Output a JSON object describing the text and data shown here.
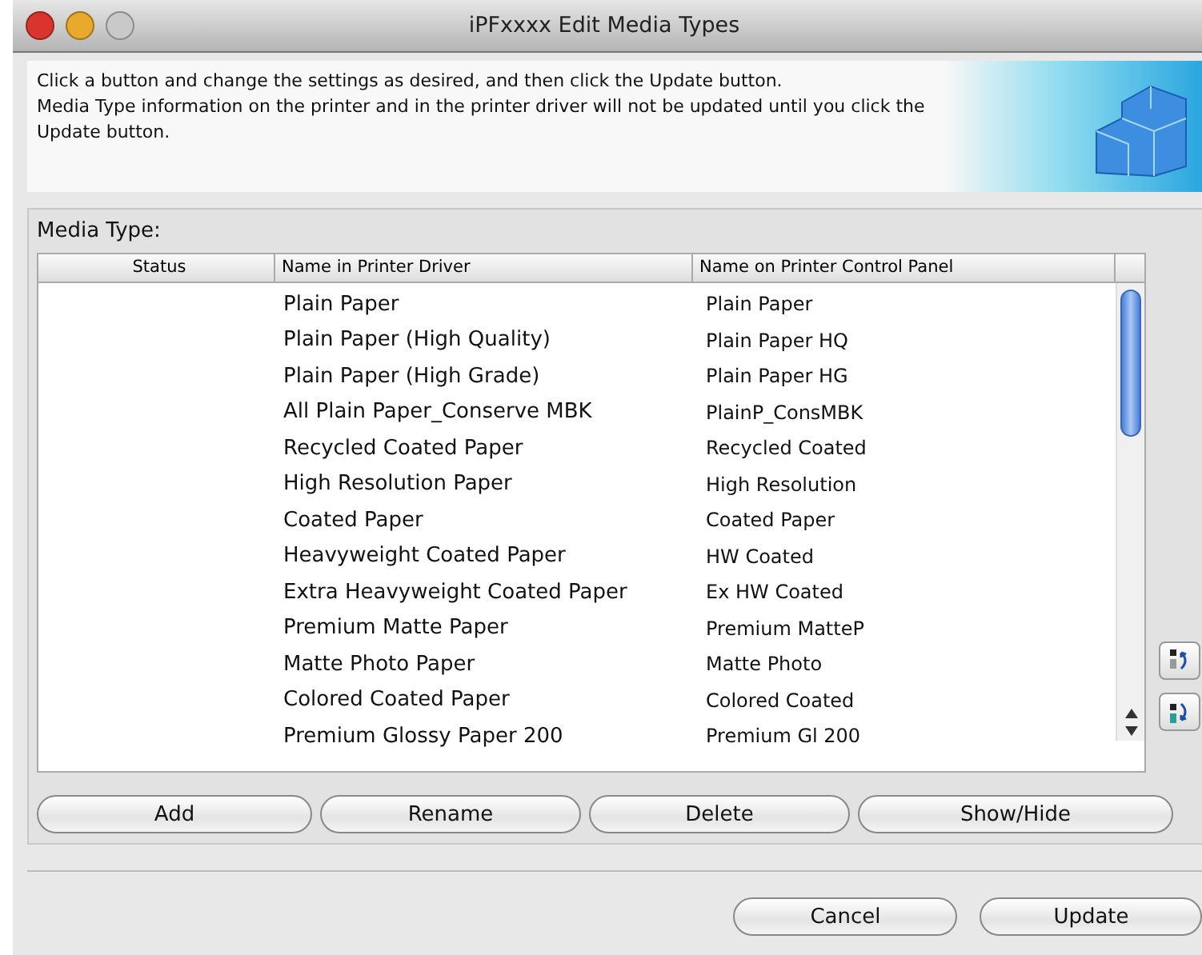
{
  "window": {
    "title": "iPFxxxx Edit Media Types"
  },
  "info": {
    "lines": [
      "Click a button and change the settings as desired, and then click the Update button.",
      "Media Type information on the printer and in the printer driver will not be updated until you click the Update button."
    ]
  },
  "media_type": {
    "label": "Media Type:",
    "table": {
      "columns": [
        "Status",
        "Name in Printer Driver",
        "Name on Printer Control Panel"
      ],
      "rows": [
        {
          "driver": "Plain Paper",
          "panel": "Plain Paper"
        },
        {
          "driver": "Plain Paper (High Quality)",
          "panel": "Plain Paper HQ"
        },
        {
          "driver": "Plain Paper (High Grade)",
          "panel": "Plain Paper HG"
        },
        {
          "driver": "All Plain Paper_Conserve MBK",
          "panel": "PlainP_ConsMBK"
        },
        {
          "driver": "Recycled Coated Paper",
          "panel": "Recycled Coated"
        },
        {
          "driver": "High Resolution Paper",
          "panel": "High Resolution"
        },
        {
          "driver": "Coated Paper",
          "panel": "Coated Paper"
        },
        {
          "driver": "Heavyweight Coated Paper",
          "panel": "HW Coated"
        },
        {
          "driver": "Extra Heavyweight Coated Paper",
          "panel": "Ex HW Coated"
        },
        {
          "driver": "Premium Matte Paper",
          "panel": "Premium MatteP"
        },
        {
          "driver": "Matte Photo Paper",
          "panel": "Matte Photo"
        },
        {
          "driver": "Colored Coated Paper",
          "panel": "Colored Coated"
        },
        {
          "driver": "Premium Glossy Paper 200",
          "panel": "Premium Gl 200"
        }
      ]
    },
    "buttons": [
      "Add",
      "Rename",
      "Delete",
      "Show/Hide"
    ]
  },
  "footer_buttons": [
    "Cancel",
    "Update"
  ]
}
